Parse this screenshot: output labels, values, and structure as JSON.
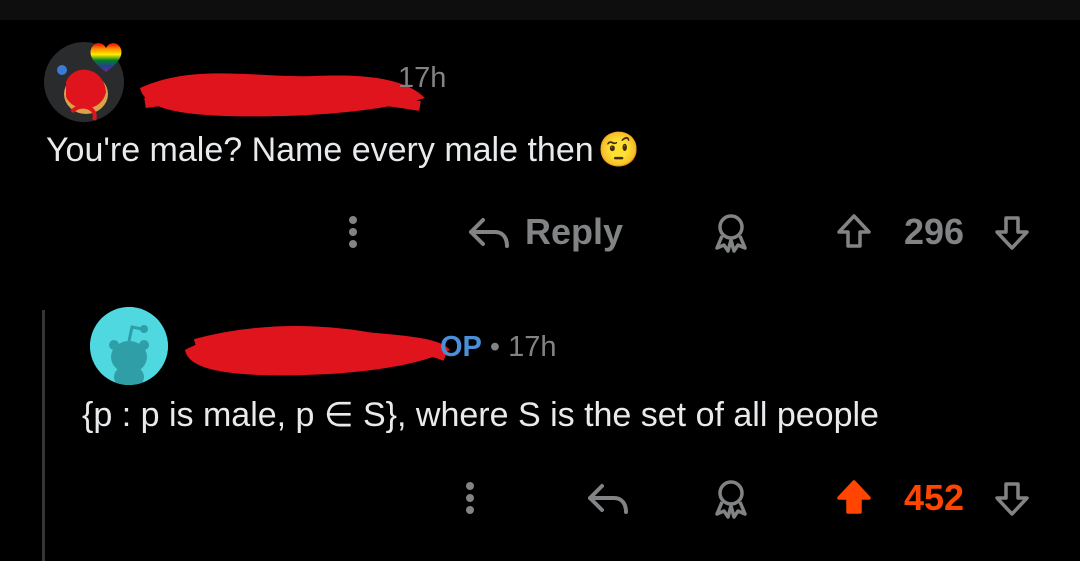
{
  "comments": [
    {
      "time": "17h",
      "body": "You're male? Name every male then",
      "emoji": "🤨",
      "actions": {
        "more": "⋮",
        "reply_label": "Reply",
        "score": "296"
      },
      "upvoted": false
    },
    {
      "op_badge": "OP",
      "separator": "•",
      "time": "17h",
      "body": "{p : p is male, p ∈ S}, where S is the set of all people",
      "actions": {
        "more": "⋮",
        "score": "452"
      },
      "upvoted": true
    }
  ],
  "colors": {
    "background": "#000000",
    "text": "#e8eaec",
    "muted": "#818384",
    "op": "#4a8fd8",
    "upvote": "#ff4500",
    "redaction": "#e0141c",
    "avatar2": "#4fd8e0"
  }
}
